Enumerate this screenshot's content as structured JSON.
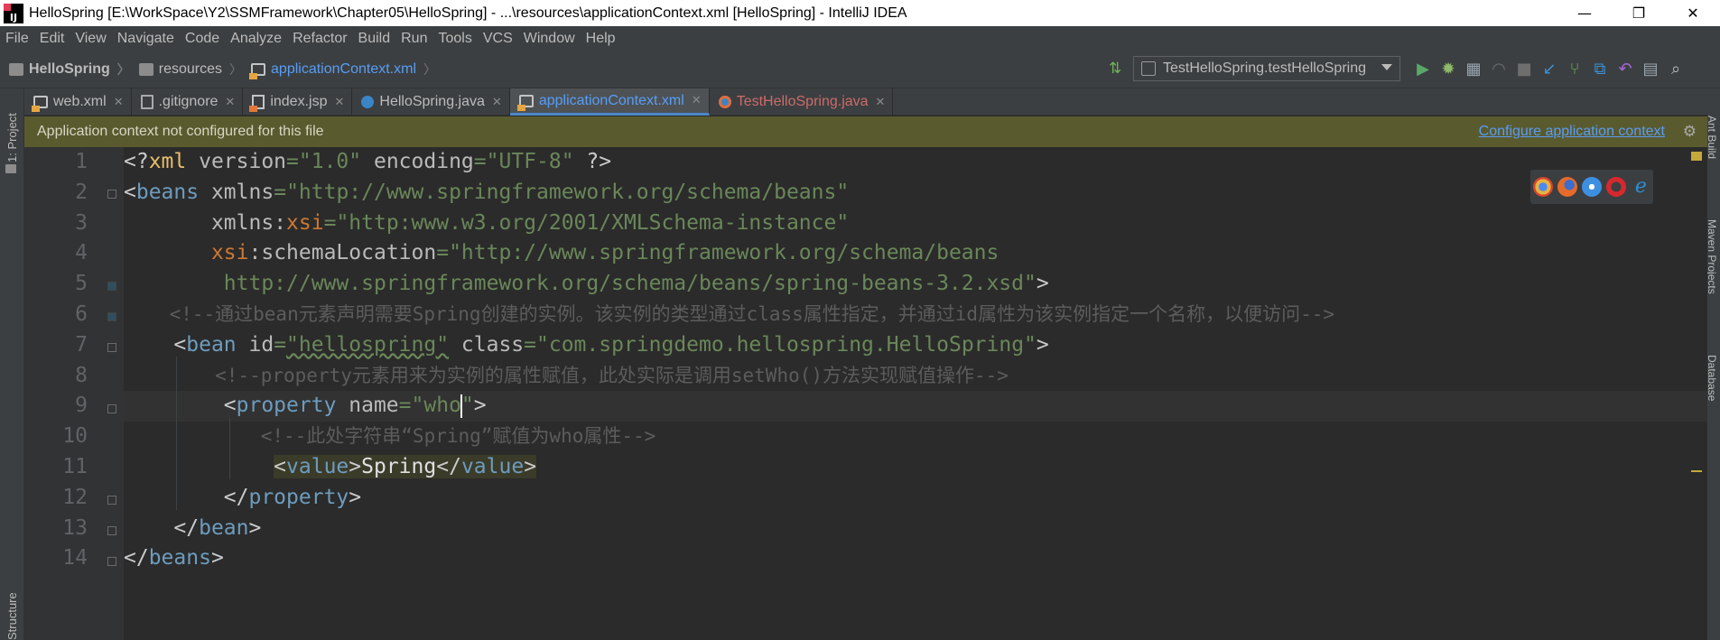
{
  "window": {
    "title": "HelloSpring [E:\\WorkSpace\\Y2\\SSMFramework\\Chapter05\\HelloSpring] - ...\\resources\\applicationContext.xml [HelloSpring] - IntelliJ IDEA",
    "app_icon_letters": "IJ",
    "controls": [
      "—",
      "❐",
      "✕"
    ]
  },
  "menu": [
    "File",
    "Edit",
    "View",
    "Navigate",
    "Code",
    "Analyze",
    "Refactor",
    "Build",
    "Run",
    "Tools",
    "VCS",
    "Window",
    "Help"
  ],
  "breadcrumb": [
    "HelloSpring",
    "resources",
    "applicationContext.xml"
  ],
  "run_config": "TestHelloSpring.testHelloSpring",
  "tabs": [
    {
      "label": "web.xml",
      "icon": "xml-file-icon"
    },
    {
      "label": ".gitignore",
      "icon": "file-icon"
    },
    {
      "label": "index.jsp",
      "icon": "jsp-file-icon"
    },
    {
      "label": "HelloSpring.java",
      "icon": "java-class-icon"
    },
    {
      "label": "applicationContext.xml",
      "icon": "xml-file-icon",
      "active": true
    },
    {
      "label": "TestHelloSpring.java",
      "icon": "java-test-class-icon"
    }
  ],
  "banner": {
    "message": "Application context not configured for this file",
    "action": "Configure application context"
  },
  "side_tabs": {
    "left_top": "1: Project",
    "left_bottom": "Structure",
    "right": [
      "Ant Build",
      "Maven Projects",
      "Database"
    ]
  },
  "line_numbers": [
    "1",
    "2",
    "3",
    "4",
    "5",
    "6",
    "7",
    "8",
    "9",
    "10",
    "11",
    "12",
    "13",
    "14"
  ],
  "code": {
    "l1": {
      "a": "<?",
      "b": "xml",
      "c": " version",
      "d": "=",
      "e": "\"1.0\"",
      "f": " encoding",
      "g": "=",
      "h": "\"UTF-8\"",
      "i": " ?>"
    },
    "l2": {
      "a": "<",
      "b": "beans",
      "c": " xmlns",
      "d": "=",
      "e": "\"http://www.springframework.org/schema/beans\""
    },
    "l3": {
      "ind": "       ",
      "a": "xmlns",
      "b": ":",
      "c": "xsi",
      "d": "=",
      "e": "\"http:www.w3.org/2001/XMLSchema-instance\""
    },
    "l4": {
      "ind": "       ",
      "a": "xsi",
      "b": ":",
      "c": "schemaLocation",
      "d": "=",
      "e": "\"http://www.springframework.org/schema/beans"
    },
    "l5": {
      "ind": "        ",
      "a": "http://www.springframework.org/schema/beans/spring-beans-3.2.xsd\"",
      "b": ">"
    },
    "l6": {
      "ind": "    ",
      "a": "<!--通过bean元素声明需要Spring创建的实例。该实例的类型通过class属性指定，并通过id属性为该实例指定一个名称，以便访问-->"
    },
    "l7": {
      "ind": "    ",
      "a": "<",
      "b": "bean",
      "c": " id",
      "d": "=",
      "e": "\"hellospring\"",
      "f": " class",
      "g": "=",
      "h": "\"com.springdemo.hellospring.HelloSpring\"",
      "i": ">"
    },
    "l8": {
      "ind": "        ",
      "a": "<!--property元素用来为实例的属性赋值，此处实际是调用setWho()方法实现赋值操作-->"
    },
    "l9": {
      "ind": "        ",
      "a": "<",
      "b": "property",
      "c": " name",
      "d": "=",
      "e": "\"who\"",
      "f": ">"
    },
    "l10": {
      "ind": "            ",
      "a": "<!--此处字符串“Spring”赋值为who属性-->"
    },
    "l11": {
      "ind": "            ",
      "a": "<",
      "b": "value",
      "c": ">",
      "d": "Spring",
      "e": "</",
      "f": "value",
      "g": ">"
    },
    "l12": {
      "ind": "        ",
      "a": "</",
      "b": "property",
      "c": ">"
    },
    "l13": {
      "ind": "    ",
      "a": "</",
      "b": "bean",
      "c": ">"
    },
    "l14": {
      "a": "</",
      "b": "beans",
      "c": ">"
    }
  },
  "colors": {
    "editor_bg": "#2b2b2b",
    "tag": "#e8bf6a",
    "attr": "#bababa",
    "string": "#6a8759",
    "namespace": "#9876aa",
    "comment": "#5c5c5c",
    "link": "#589df6",
    "banner_bg": "#5a5a2f"
  }
}
